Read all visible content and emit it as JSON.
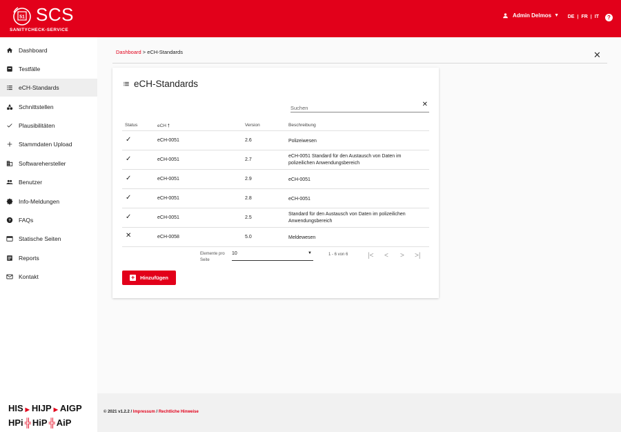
{
  "header": {
    "logo_text": "SCS",
    "logo_mark_number": "51",
    "logo_subtitle": "SANITYCHECK-SERVICE",
    "user_name": "Admin Delmos",
    "languages": [
      "DE",
      "FR",
      "IT"
    ],
    "brand_color": "#e2001a"
  },
  "sidebar": {
    "items": [
      {
        "label": "Dashboard",
        "icon": "home-icon"
      },
      {
        "label": "Testfälle",
        "icon": "inbox-icon"
      },
      {
        "label": "eCH-Standards",
        "icon": "list-icon",
        "active": true
      },
      {
        "label": "Schnittstellen",
        "icon": "category-icon"
      },
      {
        "label": "Plausibilitäten",
        "icon": "check-icon"
      },
      {
        "label": "Stammdaten Upload",
        "icon": "plus-icon"
      },
      {
        "label": "Softwarehersteller",
        "icon": "building-icon"
      },
      {
        "label": "Benutzer",
        "icon": "people-icon"
      },
      {
        "label": "Info-Meldungen",
        "icon": "info-badge-icon"
      },
      {
        "label": "FAQs",
        "icon": "help-icon"
      },
      {
        "label": "Statische Seiten",
        "icon": "web-page-icon"
      },
      {
        "label": "Reports",
        "icon": "report-icon"
      },
      {
        "label": "Kontakt",
        "icon": "mail-icon"
      }
    ],
    "partner_line1": [
      "HIS",
      "HIJP",
      "AIGP"
    ],
    "partner_line2": [
      "HPi",
      "HiP",
      "AiP"
    ]
  },
  "breadcrumb": {
    "home": "Dashboard",
    "separator": ">",
    "current": "eCH-Standards"
  },
  "card": {
    "title": "eCH-Standards",
    "search_placeholder": "Suchen",
    "columns": {
      "status": "Status",
      "ech": "eCH",
      "version": "Version",
      "description": "Beschreibung"
    },
    "rows": [
      {
        "status": "✓",
        "ech": "eCH-0051",
        "version": "2.6",
        "description": "Polizeiwesen"
      },
      {
        "status": "✓",
        "ech": "eCH-0051",
        "version": "2.7",
        "description": "eCH-0051 Standard für den Austausch von Daten im polizeilichen Anwendungsbereich"
      },
      {
        "status": "✓",
        "ech": "eCH-0051",
        "version": "2.9",
        "description": "eCH-0051"
      },
      {
        "status": "✓",
        "ech": "eCH-0051",
        "version": "2.8",
        "description": "eCH-0051"
      },
      {
        "status": "✓",
        "ech": "eCH-0051",
        "version": "2.5",
        "description": "Standard für den Austausch von Daten im polizeilichen Anwendungsbereich"
      },
      {
        "status": "✕",
        "ech": "eCH-0058",
        "version": "5.0",
        "description": "Meldewesen"
      }
    ],
    "paginator": {
      "items_per_page_label_1": "Elemente pro",
      "items_per_page_label_2": "Seite",
      "page_size": "10",
      "range": "1 - 6 von 6"
    },
    "add_button": "Hinzufügen"
  },
  "footer": {
    "copyright": "© 2021 v1.2.2 /",
    "impressum": "Impressum",
    "slash": "/",
    "legal": "Rechtliche Hinweise"
  }
}
